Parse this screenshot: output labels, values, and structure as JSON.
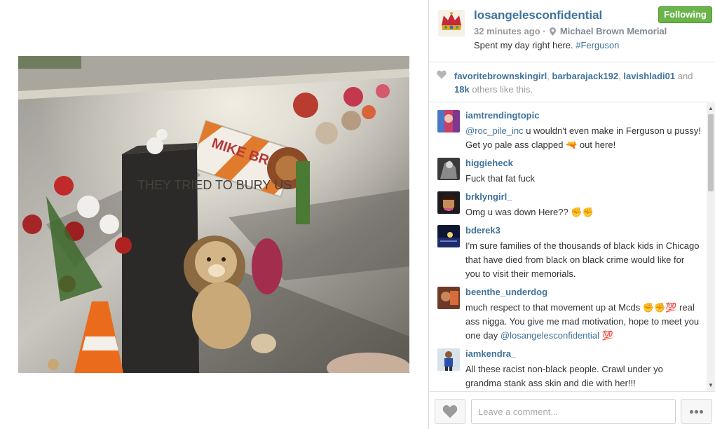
{
  "post": {
    "username": "losangelesconfidential",
    "follow_label": "Following",
    "time_ago": "32 minutes ago",
    "separator": "·",
    "location": "Michael Brown Memorial",
    "caption_text": "Spent my day right here.",
    "caption_tag": "#Ferguson",
    "photo_sign_text": "MIKE BROWN",
    "photo_box_text": "THEY TRIED TO BURY US"
  },
  "likes": {
    "user1": "favoritebrownskingirl",
    "sep1": ",",
    "user2": "barbarajack192",
    "sep2": ",",
    "user3": "lavishladi01",
    "and_text": "and",
    "count": "18k",
    "suffix": "others like this."
  },
  "comments": [
    {
      "user": "iamtrendingtopic",
      "mention": "@roc_pile_inc",
      "text": "u wouldn't even make in Ferguson u pussy! Get yo pale ass clapped 🔫 out here!",
      "tail_mention": "",
      "tail_text": ""
    },
    {
      "user": "higgieheck",
      "mention": "",
      "text": "Fuck that fat fuck",
      "tail_mention": "",
      "tail_text": ""
    },
    {
      "user": "brklyngirl_",
      "mention": "",
      "text": "Omg u was down Here?? ✊✊",
      "tail_mention": "",
      "tail_text": ""
    },
    {
      "user": "bderek3",
      "mention": "",
      "text": "I'm sure families of the thousands of black kids in Chicago that have died from black on black crime would like for you to visit their memorials.",
      "tail_mention": "",
      "tail_text": ""
    },
    {
      "user": "beenthe_underdog",
      "mention": "",
      "text": "much respect to that movement up at Mcds ✊✊💯 real ass nigga. You give me mad motivation, hope to meet you one day",
      "tail_mention": "@losangelesconfidential",
      "tail_text": "💯"
    },
    {
      "user": "iamkendra_",
      "mention": "",
      "text": "All these racist non-black people. Crawl under yo grandma stank ass skin and die with her!!!",
      "tail_mention": "",
      "tail_text": ""
    }
  ],
  "footer": {
    "comment_placeholder": "Leave a comment..."
  },
  "scrollbar": {
    "up_glyph": "▲",
    "down_glyph": "▼"
  },
  "colors": {
    "link": "#3f729b",
    "follow_green": "#6bb449",
    "muted": "#999999"
  },
  "icons": [
    "crown-avatar",
    "location-pin-icon",
    "heart-icon",
    "more-dots-icon"
  ]
}
